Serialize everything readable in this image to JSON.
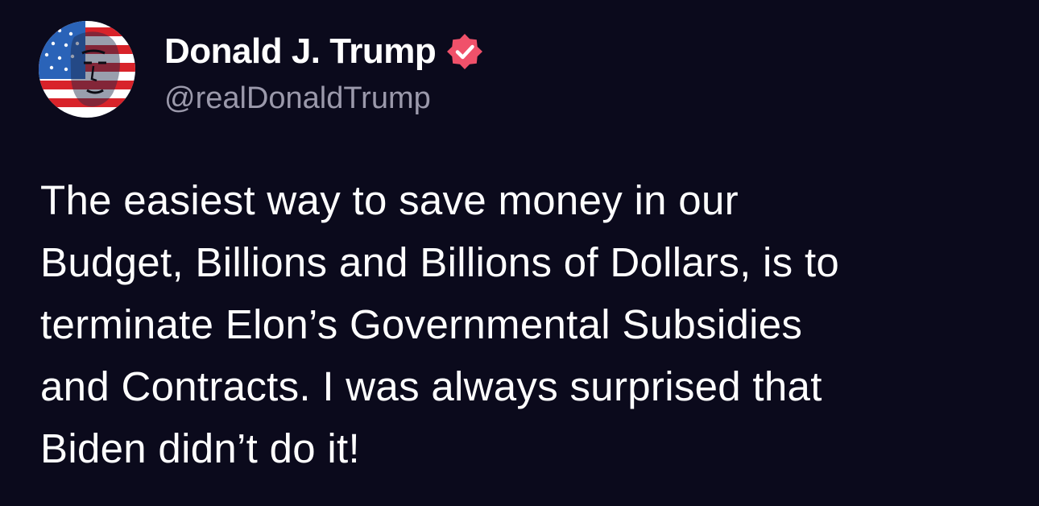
{
  "author": {
    "display_name": "Donald J. Trump",
    "handle": "@realDonaldTrump",
    "verified_icon": "verified-badge-icon",
    "verified_color": "#f0516a"
  },
  "post": {
    "lines": [
      "The easiest way to save money in our",
      "Budget, Billions and Billions of Dollars, is to",
      "terminate Elon’s Governmental Subsidies",
      "and Contracts. I was always surprised that",
      "Biden didn’t do it!"
    ]
  },
  "colors": {
    "background": "#0b0a1c",
    "name": "#ffffff",
    "handle": "#9b99ab",
    "body": "#ffffff"
  }
}
